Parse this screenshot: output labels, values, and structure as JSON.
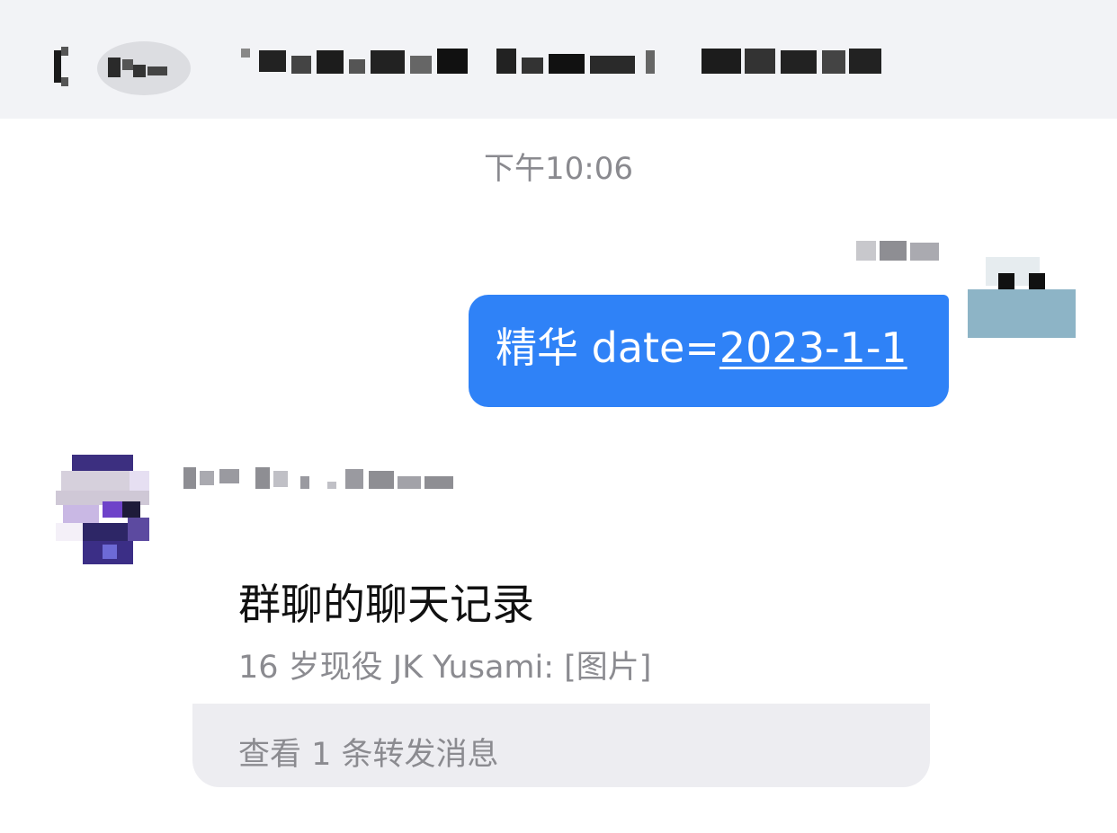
{
  "header": {
    "back_icon": "chevron-left-icon",
    "unread_count_blurred": true,
    "title_blurred": true
  },
  "timestamp": "下午10:06",
  "outgoing_message": {
    "sender_name_blurred": true,
    "text_prefix": "精华 date=",
    "link_text": "2023-1-1",
    "bubble_color": "#2f82f7"
  },
  "incoming_forward": {
    "sender_name_blurred": true,
    "card_title": "群聊的聊天记录",
    "preview_line": "16 岁现役 JK Yusami: [图片]",
    "footer_label": "查看 1 条转发消息"
  },
  "colors": {
    "header_bg": "#f2f3f6",
    "footer_bg": "#ededf1",
    "muted_text": "#8b8b90"
  }
}
